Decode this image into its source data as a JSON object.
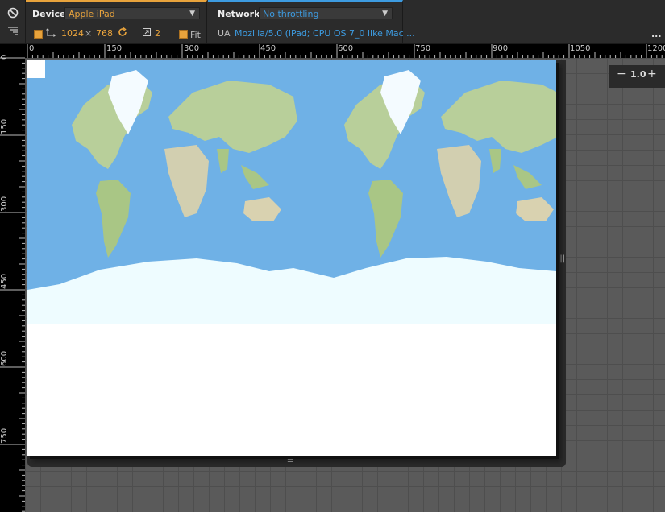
{
  "toolbar": {
    "device_label": "Device",
    "device_value": "Apple iPad",
    "width": "1024",
    "times": "×",
    "height": "768",
    "scale": "2",
    "fit_label": "Fit",
    "network_label": "Network",
    "network_value": "No throttling",
    "ua_label": "UA",
    "ua_value": "Mozilla/5.0 (iPad; CPU OS 7_0 like Mac ...",
    "more": "..."
  },
  "ruler": {
    "top_labels": [
      "0",
      "150",
      "300",
      "450",
      "600",
      "750",
      "900",
      "1050",
      "1200"
    ],
    "left_labels": [
      "0",
      "150",
      "300",
      "450",
      "600",
      "750"
    ]
  },
  "zoom": {
    "minus": "−",
    "value": "1.0",
    "plus": "+"
  },
  "colors": {
    "accent_orange": "#e8a33c",
    "accent_blue": "#3d9be0",
    "ocean": "#6fb1e6",
    "ice": "#eefcff",
    "land": "#b8cf9a"
  }
}
